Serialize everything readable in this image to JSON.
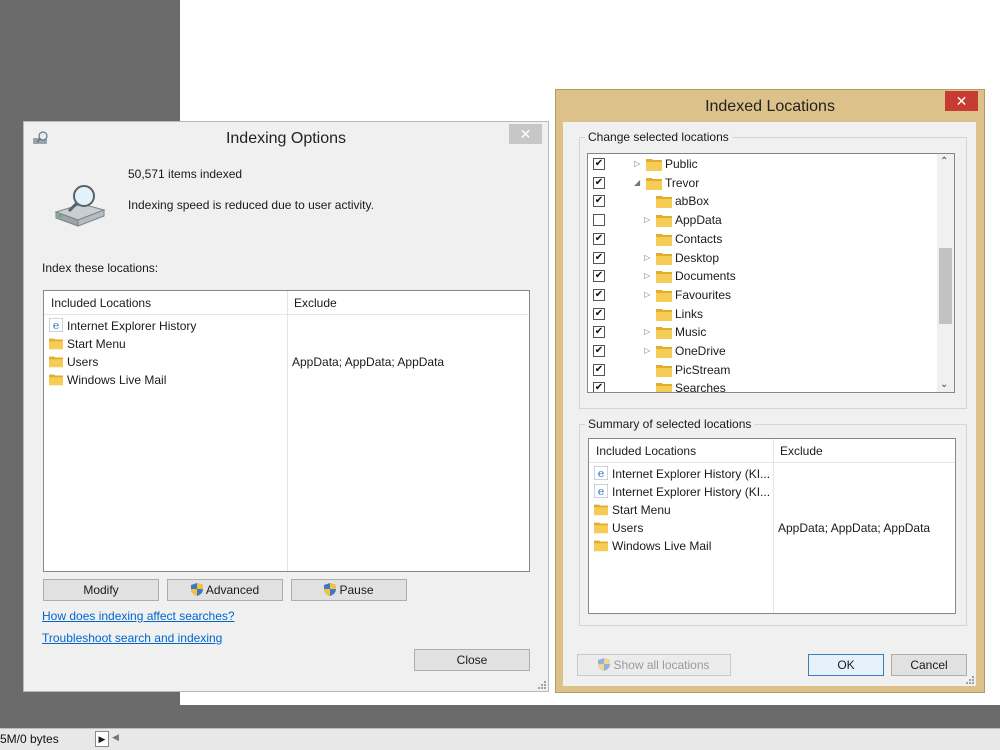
{
  "status_bar": {
    "size_text": "5M/0 bytes"
  },
  "indexing_options": {
    "title": "Indexing Options",
    "items_indexed": "50,571 items indexed",
    "status": "Indexing speed is reduced due to user activity.",
    "index_label": "Index these locations:",
    "columns": {
      "included": "Included Locations",
      "exclude": "Exclude"
    },
    "rows": [
      {
        "name": "Internet Explorer History",
        "icon": "ie-icon",
        "exclude": ""
      },
      {
        "name": "Start Menu",
        "icon": "folder-icon",
        "exclude": ""
      },
      {
        "name": "Users",
        "icon": "folder-icon",
        "exclude": "AppData; AppData; AppData"
      },
      {
        "name": "Windows Live Mail",
        "icon": "folder-icon",
        "exclude": ""
      }
    ],
    "buttons": {
      "modify": "Modify",
      "advanced": "Advanced",
      "pause": "Pause",
      "close": "Close"
    },
    "links": {
      "how": "How does indexing affect searches?",
      "troubleshoot": "Troubleshoot search and indexing"
    }
  },
  "indexed_locations": {
    "title": "Indexed Locations",
    "change_label": "Change selected locations",
    "tree": [
      {
        "label": "Public",
        "checked": true,
        "expander": "collapsed",
        "level": 0,
        "icon": "folder-icon"
      },
      {
        "label": "Trevor",
        "checked": true,
        "expander": "expanded",
        "level": 0,
        "icon": "folder-icon"
      },
      {
        "label": "abBox",
        "checked": true,
        "expander": "none",
        "level": 1,
        "icon": "folder-icon"
      },
      {
        "label": "AppData",
        "checked": false,
        "expander": "collapsed",
        "level": 1,
        "icon": "folder-icon"
      },
      {
        "label": "Contacts",
        "checked": true,
        "expander": "none",
        "level": 1,
        "icon": "contacts-folder-icon"
      },
      {
        "label": "Desktop",
        "checked": true,
        "expander": "collapsed",
        "level": 1,
        "icon": "desktop-folder-icon"
      },
      {
        "label": "Documents",
        "checked": true,
        "expander": "collapsed",
        "level": 1,
        "icon": "documents-folder-icon"
      },
      {
        "label": "Favourites",
        "checked": true,
        "expander": "collapsed",
        "level": 1,
        "icon": "favourites-folder-icon"
      },
      {
        "label": "Links",
        "checked": true,
        "expander": "none",
        "level": 1,
        "icon": "links-folder-icon"
      },
      {
        "label": "Music",
        "checked": true,
        "expander": "collapsed",
        "level": 1,
        "icon": "music-folder-icon"
      },
      {
        "label": "OneDrive",
        "checked": true,
        "expander": "collapsed",
        "level": 1,
        "icon": "onedrive-folder-icon"
      },
      {
        "label": "PicStream",
        "checked": true,
        "expander": "none",
        "level": 1,
        "icon": "folder-icon"
      },
      {
        "label": "Searches",
        "checked": true,
        "expander": "none",
        "level": 1,
        "icon": "searches-folder-icon"
      }
    ],
    "summary_label": "Summary of selected locations",
    "columns": {
      "included": "Included Locations",
      "exclude": "Exclude"
    },
    "summary_rows": [
      {
        "name": "Internet Explorer History (KI...",
        "icon": "ie-icon",
        "exclude": ""
      },
      {
        "name": "Internet Explorer History (KI...",
        "icon": "ie-icon",
        "exclude": ""
      },
      {
        "name": "Start Menu",
        "icon": "folder-icon",
        "exclude": ""
      },
      {
        "name": "Users",
        "icon": "folder-icon",
        "exclude": "AppData; AppData; AppData"
      },
      {
        "name": "Windows Live Mail",
        "icon": "folder-icon",
        "exclude": ""
      }
    ],
    "buttons": {
      "show_all": "Show all locations",
      "ok": "OK",
      "cancel": "Cancel"
    }
  },
  "colors": {
    "link": "#0066cc",
    "close_red": "#c73b32",
    "frame_tan": "#dcc18a",
    "folder": "#f2c64d"
  }
}
